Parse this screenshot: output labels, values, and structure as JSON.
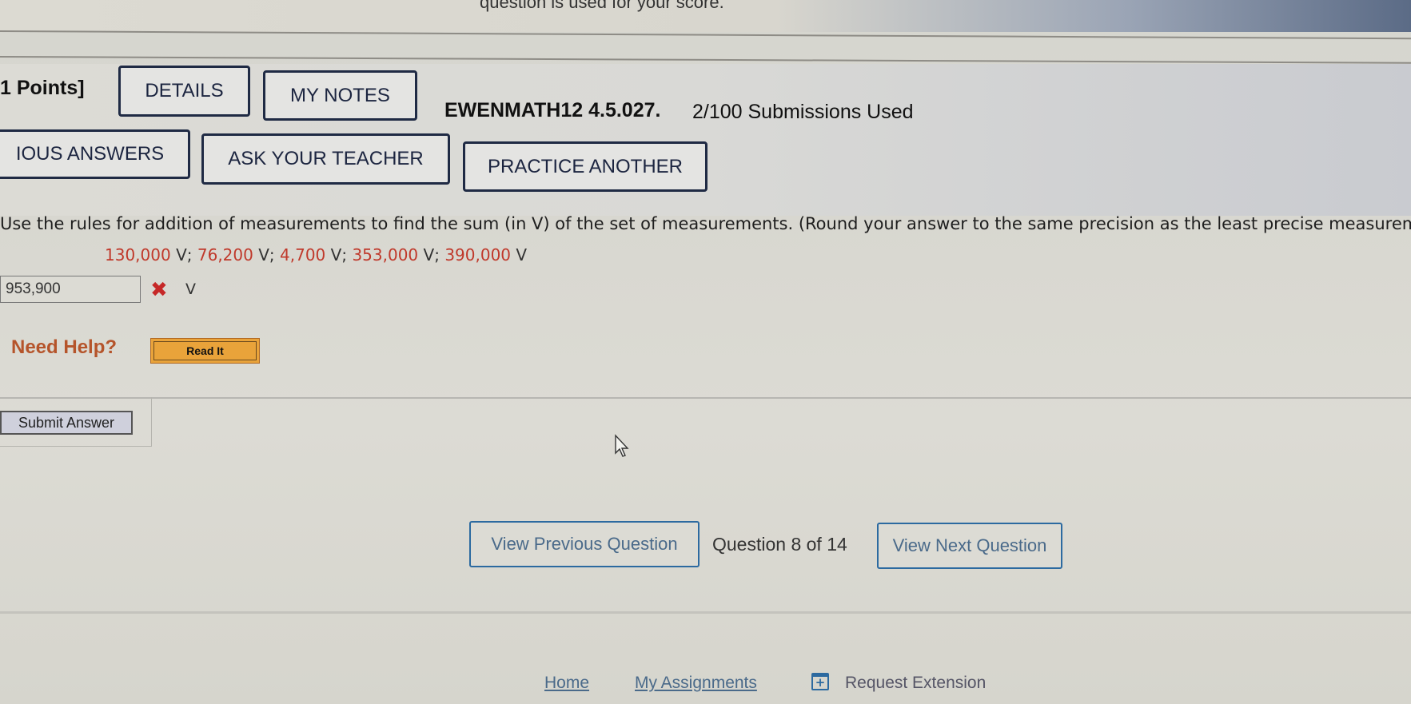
{
  "header": {
    "top_note": "question is used for your score.",
    "points_label": "1 Points]",
    "details_button": "DETAILS",
    "my_notes_button": "MY NOTES",
    "question_id": "EWENMATH12 4.5.027.",
    "submissions": "2/100 Submissions Used"
  },
  "actions": {
    "previous_answers_button": "IOUS ANSWERS",
    "ask_teacher_button": "ASK YOUR TEACHER",
    "practice_another_button": "PRACTICE ANOTHER"
  },
  "question": {
    "prompt": "Use the rules for addition of measurements to find the sum (in V) of the set of measurements. (Round your answer to the same precision as the least precise measuremer",
    "measurements": [
      {
        "value": "130,000",
        "unit": " V",
        "sep": "; "
      },
      {
        "value": "76,200",
        "unit": " V",
        "sep": "; "
      },
      {
        "value": "4,700",
        "unit": " V",
        "sep": "; "
      },
      {
        "value": "353,000",
        "unit": " V",
        "sep": "; "
      },
      {
        "value": "390,000",
        "unit": " V",
        "sep": ""
      }
    ],
    "answer_value": "953,900",
    "answer_status": "incorrect",
    "answer_status_icon": "✖",
    "answer_unit": "V",
    "colors": {
      "measurement": "#c0392b",
      "incorrect": "#c62828"
    }
  },
  "help": {
    "label": "Need Help?",
    "read_it_button": "Read It",
    "color": "#b5542a",
    "button_color": "#e9a33a"
  },
  "submit": {
    "button": "Submit Answer"
  },
  "navigation": {
    "previous_button": "View Previous Question",
    "counter": "Question 8 of 14",
    "next_button": "View Next Question",
    "accent": "#2c6aa0"
  },
  "footer": {
    "home_link": "Home",
    "assignments_link": "My Assignments",
    "extension_icon": "+",
    "extension_label": "Request Extension"
  }
}
